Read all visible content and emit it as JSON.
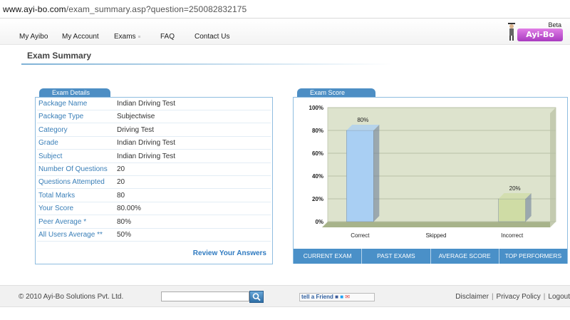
{
  "browser": {
    "url_host": "www.ayi-bo.com",
    "url_path": "/exam_summary.asp?question=250082832175"
  },
  "nav": {
    "items": [
      "My Ayibo",
      "My Account",
      "Exams",
      "FAQ",
      "Contact Us"
    ]
  },
  "logo": {
    "beta": "Beta",
    "text": "Ayi-Bo"
  },
  "page": {
    "title": "Exam Summary"
  },
  "details": {
    "tab": "Exam Details",
    "rows": [
      {
        "key": "Package Name",
        "value": "Indian Driving Test"
      },
      {
        "key": "Package Type",
        "value": "Subjectwise"
      },
      {
        "key": "Category",
        "value": "Driving Test"
      },
      {
        "key": "Grade",
        "value": "Indian Driving Test"
      },
      {
        "key": "Subject",
        "value": "Indian Driving Test"
      },
      {
        "key": "Number Of Questions",
        "value": "20"
      },
      {
        "key": "Questions Attempted",
        "value": "20"
      },
      {
        "key": "Total Marks",
        "value": "80"
      },
      {
        "key": "Your Score",
        "value": "80.00%"
      },
      {
        "key": "Peer Average *",
        "value": "80%"
      },
      {
        "key": "All Users Average **",
        "value": "50%"
      }
    ],
    "review_link": "Review Your Answers"
  },
  "score": {
    "tab": "Exam Score",
    "tabs": [
      "CURRENT EXAM",
      "PAST EXAMS",
      "AVERAGE SCORE",
      "TOP PERFORMERS"
    ]
  },
  "chart_data": {
    "type": "bar",
    "categories": [
      "Correct",
      "Skipped",
      "Incorrect"
    ],
    "values": [
      80,
      0,
      20
    ],
    "value_labels": [
      "80%",
      "",
      "20%"
    ],
    "ylim": [
      0,
      100
    ],
    "yticks": [
      "0%",
      "20%",
      "40%",
      "60%",
      "80%",
      "100%"
    ],
    "colors": [
      "#a9cff3",
      "#cfcfcf",
      "#cfdca5"
    ],
    "background": "#dde3cd",
    "grid": true
  },
  "footer": {
    "copyright": "© 2010 Ayi-Bo Solutions Pvt. Ltd.",
    "tell_a_friend": "tell a Friend",
    "links": [
      "Disclaimer",
      "Privacy Policy",
      "Logout"
    ]
  }
}
